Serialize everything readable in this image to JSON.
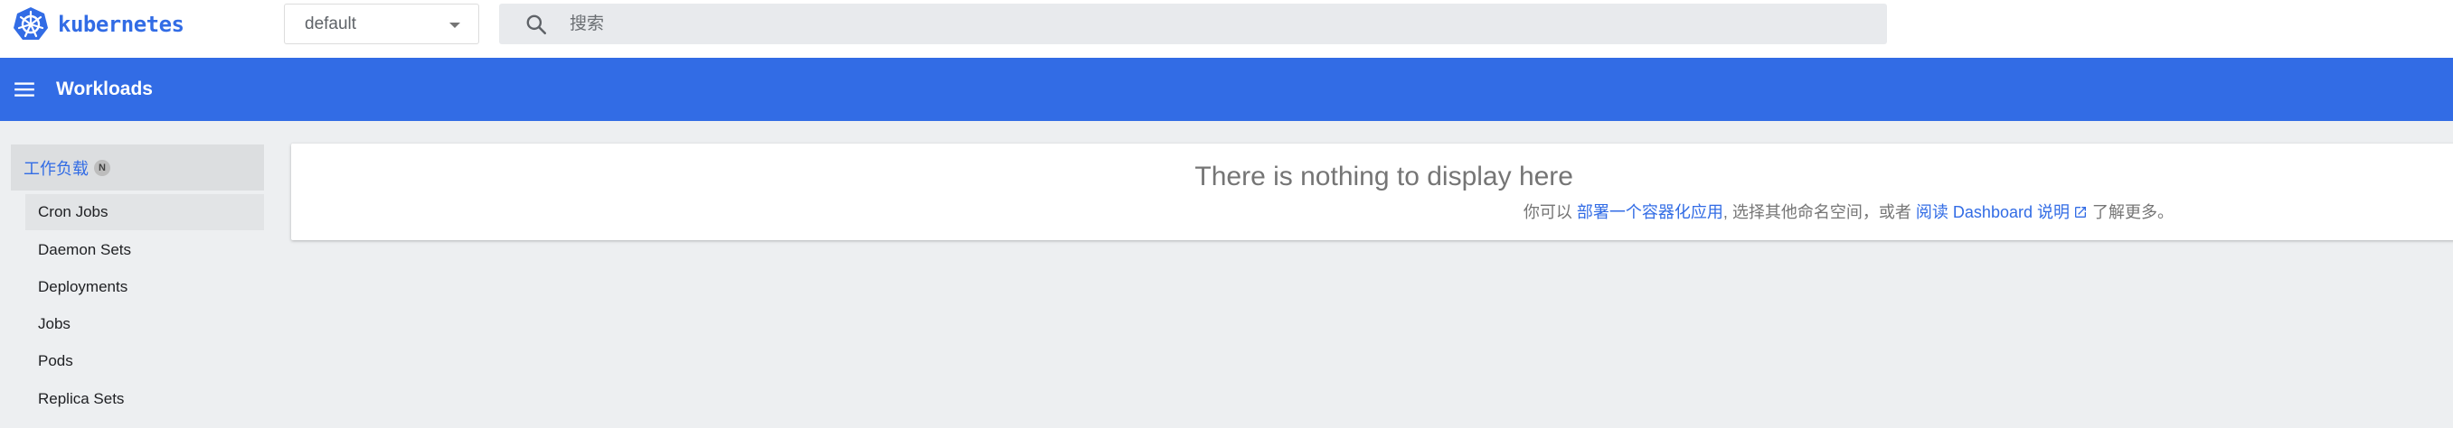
{
  "brand": {
    "name": "kubernetes",
    "color": "#326ce5",
    "logo_icon": "kubernetes-helm-wheel-icon"
  },
  "namespace": {
    "selected": "default",
    "icon": "dropdown-arrow-icon"
  },
  "search": {
    "placeholder": "搜索",
    "icon": "search-icon"
  },
  "toolbar": {
    "title": "Workloads",
    "menu_icon": "hamburger-menu-icon",
    "background": "#326ce5"
  },
  "sidebar": {
    "group": {
      "label": "工作负载",
      "badge": "N"
    },
    "items": [
      {
        "label": "Cron Jobs"
      },
      {
        "label": "Daemon Sets"
      },
      {
        "label": "Deployments"
      },
      {
        "label": "Jobs"
      },
      {
        "label": "Pods"
      },
      {
        "label": "Replica Sets"
      }
    ]
  },
  "empty_state": {
    "heading": "There is nothing to display here",
    "text_prefix": "你可以 ",
    "deploy_link": "部署一个容器化应用",
    "text_middle": ", 选择其他命名空间，或者 ",
    "docs_link": "阅读 Dashboard 说明",
    "docs_icon": "open-in-new-icon",
    "text_suffix": " 了解更多。"
  }
}
